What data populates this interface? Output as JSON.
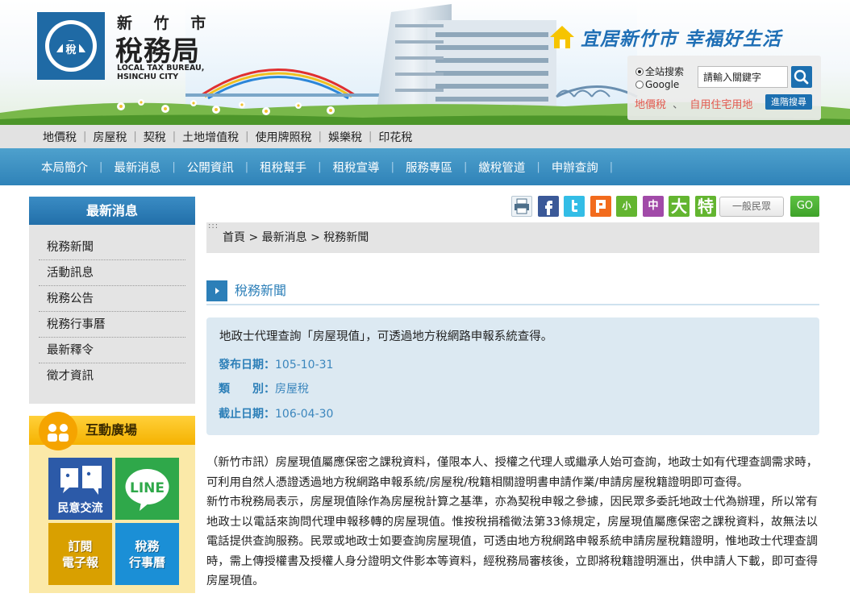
{
  "header": {
    "logo_sub": "新 竹 市",
    "logo_main": "稅務局",
    "logo_en_1": "LOCAL TAX BUREAU,",
    "logo_en_2": "HSINCHU CITY",
    "logo_emblem_char": "稅",
    "slogan": "宜居新竹市  幸福好生活"
  },
  "search": {
    "option_site": "全站搜索",
    "option_google": "Google",
    "placeholder": "請輸入關鍵字",
    "hot_link_1": "地價稅",
    "hot_sep": "、",
    "hot_link_2": "自用住宅用地",
    "advanced_label": "進階搜尋"
  },
  "tax_menu": [
    "地價稅",
    "房屋稅",
    "契稅",
    "土地增值稅",
    "使用牌照稅",
    "娛樂稅",
    "印花稅"
  ],
  "main_nav": [
    "本局簡介",
    "最新消息",
    "公開資訊",
    "租稅幫手",
    "租稅宣導",
    "服務專區",
    "繳稅管道",
    "申辦查詢"
  ],
  "sidebar": {
    "title": "最新消息",
    "items": [
      "稅務新聞",
      "活動訊息",
      "稅務公告",
      "稅務行事曆",
      "最新釋令",
      "徵才資訊"
    ]
  },
  "interact": {
    "title": "互動廣場",
    "tile_1": "民意交流",
    "tile_2_logo": "LINE",
    "tile_3_line1": "訂閱",
    "tile_3_line2": "電子報",
    "tile_4_line1": "稅務",
    "tile_4_line2": "行事曆"
  },
  "tools": {
    "font_small": "小",
    "font_medium": "中",
    "font_large": "大",
    "font_xlarge": "特",
    "mode_label": "一般民眾",
    "go_label": "GO"
  },
  "breadcrumb": "首頁 > 最新消息 > 稅務新聞",
  "breadcrumb_dots": ":::",
  "section_title": "稅務新聞",
  "news": {
    "title": "地政士代理查詢「房屋現值」，可透過地方稅網路申報系統查得。",
    "publish_label": "發布日期：",
    "publish_value": "105-10-31",
    "category_label": "類　　別：",
    "category_value": "房屋稅",
    "expire_label": "截止日期：",
    "expire_value": "106-04-30"
  },
  "article": {
    "p1": "（新竹市訊）房屋現值屬應保密之課稅資料，僅限本人、授權之代理人或繼承人始可查詢，地政士如有代理查調需求時，可利用自然人憑證透過地方稅網路申報系統/房屋稅/稅籍相關證明書申請作業/申請房屋稅籍證明即可查得。",
    "p2": "新竹市稅務局表示，房屋現值除作為房屋稅計算之基準，亦為契稅申報之參據，因民眾多委託地政士代為辦理，所以常有地政士以電話來詢問代理申報移轉的房屋現值。惟按稅捐稽徵法第33條規定，房屋現值屬應保密之課稅資料，故無法以電話提供查詢服務。民眾或地政士如要查詢房屋現值，可透由地方稅網路申報系統申請房屋稅籍證明，惟地政士代理查調時，需上傳授權書及授權人身分證明文件影本等資料，經稅務局審核後，立即將稅籍證明滙出，供申請人下載，即可查得房屋現值。"
  },
  "colors": {
    "nav_blue": "#2f82b8",
    "accent_blue": "#2c7fb8",
    "info_bg": "#dce9f2",
    "hot_link_red": "#e2574c",
    "go_green": "#3ea229"
  }
}
